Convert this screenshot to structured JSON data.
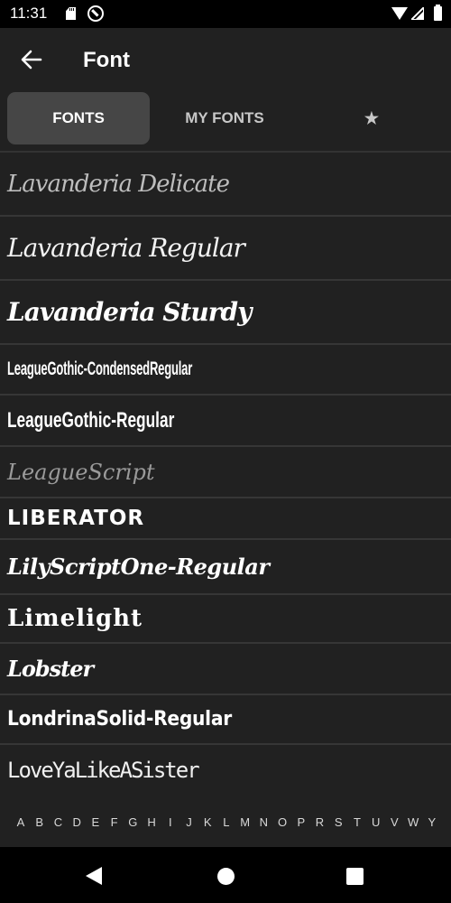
{
  "status_bar": {
    "time": "11:31",
    "icons": [
      "sd-card-icon",
      "data-saver-icon",
      "wifi-icon",
      "signal-icon",
      "battery-icon"
    ]
  },
  "app_bar": {
    "title": "Font",
    "back_icon": "arrow-left-icon"
  },
  "tabs": [
    {
      "label": "FONTS",
      "selected": true
    },
    {
      "label": "MY FONTS",
      "selected": false
    },
    {
      "label": "★",
      "icon": "star-icon",
      "selected": false
    }
  ],
  "fonts": [
    {
      "name": "Lavanderia Delicate"
    },
    {
      "name": "Lavanderia Regular"
    },
    {
      "name": "Lavanderia Sturdy"
    },
    {
      "name": "LeagueGothic-CondensedRegular"
    },
    {
      "name": "LeagueGothic-Regular"
    },
    {
      "name": "LeagueScript"
    },
    {
      "name": "LIBERATOR"
    },
    {
      "name": "LilyScriptOne-Regular"
    },
    {
      "name": "Limelight"
    },
    {
      "name": "Lobster"
    },
    {
      "name": "LondrinaSolid-Regular"
    },
    {
      "name": "LoveYaLikeASister"
    }
  ],
  "alphabet": [
    "A",
    "B",
    "C",
    "D",
    "E",
    "F",
    "G",
    "H",
    "I",
    "J",
    "K",
    "L",
    "M",
    "N",
    "O",
    "P",
    "R",
    "S",
    "T",
    "U",
    "V",
    "W",
    "Y"
  ],
  "nav_bar": {
    "icons": [
      "back-triangle-icon",
      "home-circle-icon",
      "recents-square-icon"
    ]
  },
  "colors": {
    "background": "#212121",
    "status_bar": "#000000",
    "selected_tab": "#464646",
    "divider": "#363636",
    "text": "#ffffff"
  }
}
